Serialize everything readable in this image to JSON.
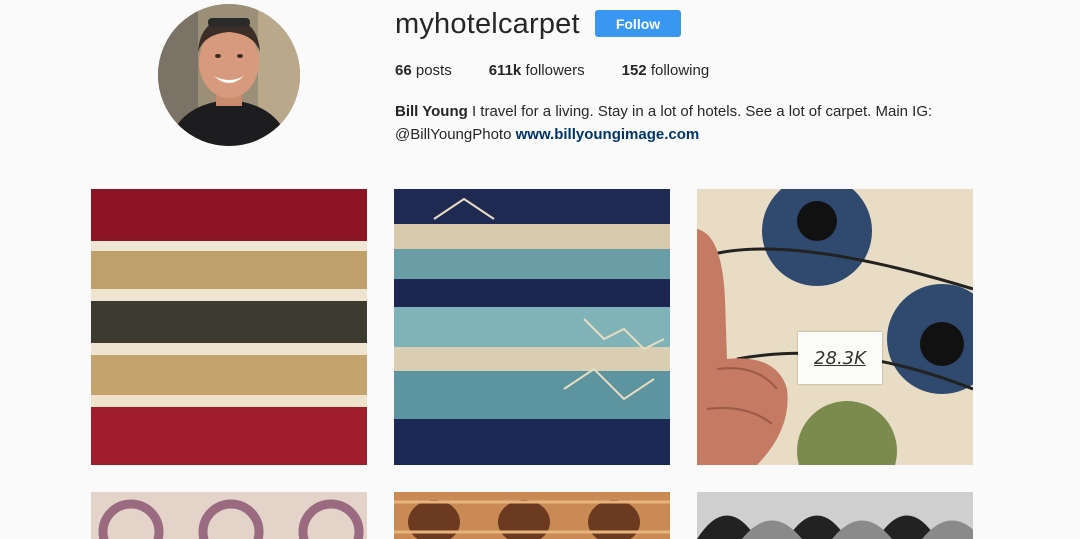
{
  "profile": {
    "username": "myhotelcarpet",
    "follow_label": "Follow",
    "stats": {
      "posts_count": "66",
      "posts_label": "posts",
      "followers_count": "611k",
      "followers_label": "followers",
      "following_count": "152",
      "following_label": "following"
    },
    "bio": {
      "name": "Bill Young",
      "text_line1": "I travel for a living. Stay in a lot of hotels. See a lot of carpet. Main IG:",
      "handle": "@BillYoungPhoto",
      "website": "www.billyoungimage.com"
    }
  },
  "posts": {
    "tile3_note": "28.3K"
  },
  "colors": {
    "follow_button": "#3897f0",
    "link": "#003569",
    "background": "#fafafa"
  }
}
